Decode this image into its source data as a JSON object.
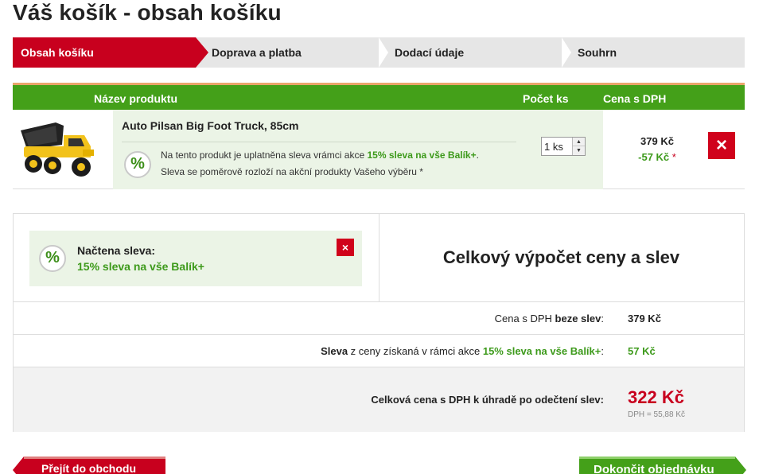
{
  "page": {
    "title": "Váš košík - obsah košíku"
  },
  "steps": [
    {
      "label": "Obsah košíku",
      "active": true
    },
    {
      "label": "Doprava a platba",
      "active": false
    },
    {
      "label": "Dodací údaje",
      "active": false
    },
    {
      "label": "Souhrn",
      "active": false
    }
  ],
  "cart": {
    "headers": {
      "product": "Název produktu",
      "quantity": "Počet ks",
      "price": "Cena s DPH"
    },
    "items": [
      {
        "name": "Auto Pilsan Big Foot Truck, 85cm",
        "discount_badge": "%",
        "discount_text_prefix": "Na tento produkt je uplatněna sleva vrámci akce",
        "discount_name": "15% sleva na vše Balík+",
        "discount_text_suffix": ".",
        "discount_note": "Sleva se poměrově rozloží na akční produkty Vašeho výběru *",
        "quantity": "1 ks",
        "price": "379 Kč",
        "discount_amount": "-57 Kč",
        "discount_star": "*",
        "remove_icon": "×"
      }
    ]
  },
  "summary": {
    "loaded_discount": {
      "badge": "%",
      "title": "Načtena sleva:",
      "value": "15% sleva na vše Balík+",
      "remove_icon": "×"
    },
    "calc_title": "Celkový výpočet ceny a slev",
    "rows": {
      "base_label_prefix": "Cena s DPH ",
      "base_label_bold": "beze slev",
      "base_label_suffix": ":",
      "base_value": "379 Kč",
      "discount_label_bold": "Sleva",
      "discount_label_middle": " z ceny získaná v rámci akce ",
      "discount_label_green": "15% sleva na vše Balík+",
      "discount_label_suffix": ":",
      "discount_value": "57 Kč",
      "total_label": "Celková cena s DPH k úhradě po odečtení slev:",
      "total_value": "322 Kč",
      "vat_note": "DPH = 55,88 Kč"
    }
  },
  "buttons": {
    "back": "Přejít do obchodu",
    "finish": "Dokončit objednávku"
  },
  "colors": {
    "accent_red": "#c8001e",
    "accent_green": "#44a019",
    "discount_green": "#3d9a1b"
  }
}
